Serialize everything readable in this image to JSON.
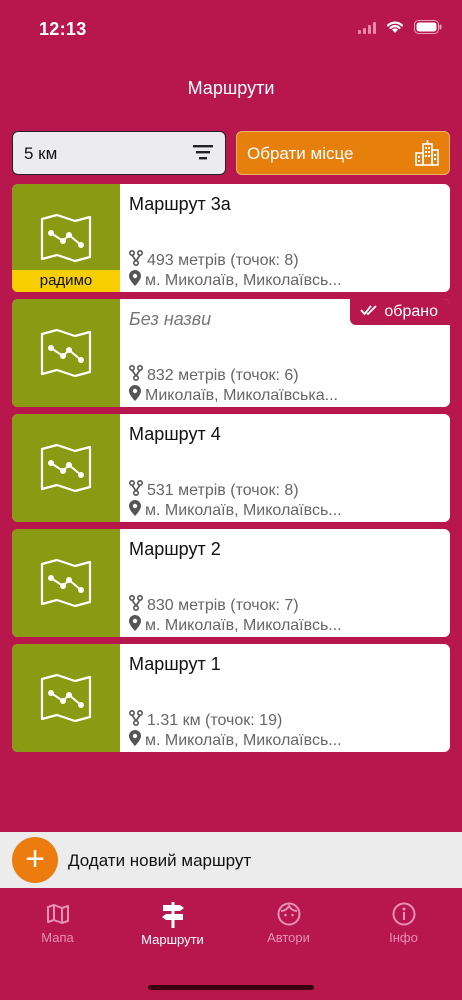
{
  "status": {
    "time": "12:13"
  },
  "header": {
    "title": "Маршрути"
  },
  "filter": {
    "value": "5 км"
  },
  "place_button": {
    "label": "Обрати місце"
  },
  "routes": [
    {
      "title": "Маршрут 3а",
      "distance": "493 метрів (точок: 8)",
      "location": "м. Миколаїв, Миколаївсь...",
      "badge": "радимо",
      "badge_icon": "star-icon"
    },
    {
      "title": "Без назви",
      "distance": "832 метрів (точок: 6)",
      "location": "Миколаїв, Миколаївська...",
      "badge": "обрано",
      "badge_icon": "double-check-icon"
    },
    {
      "title": "Маршрут 4",
      "distance": "531 метрів (точок: 8)",
      "location": "м. Миколаїв, Миколаївсь..."
    },
    {
      "title": "Маршрут 2",
      "distance": "830 метрів (точок: 7)",
      "location": "м. Миколаїв, Миколаївсь..."
    },
    {
      "title": "Маршрут 1",
      "distance": "1.31 км (точок: 19)",
      "location": "м. Миколаїв, Миколаївсь..."
    }
  ],
  "add_route": {
    "label": "Додати новий маршрут",
    "icon": "plus-icon"
  },
  "tabs": [
    {
      "label": "Мапа",
      "icon": "map-icon"
    },
    {
      "label": "Маршрути",
      "icon": "signpost-icon",
      "active": true
    },
    {
      "label": "Автори",
      "icon": "face-icon"
    },
    {
      "label": "Інфо",
      "icon": "info-icon"
    }
  ],
  "colors": {
    "primary": "#b8174e",
    "accent": "#e77f0d",
    "thumb": "#8b9a13",
    "recommended": "#f7cf00"
  }
}
